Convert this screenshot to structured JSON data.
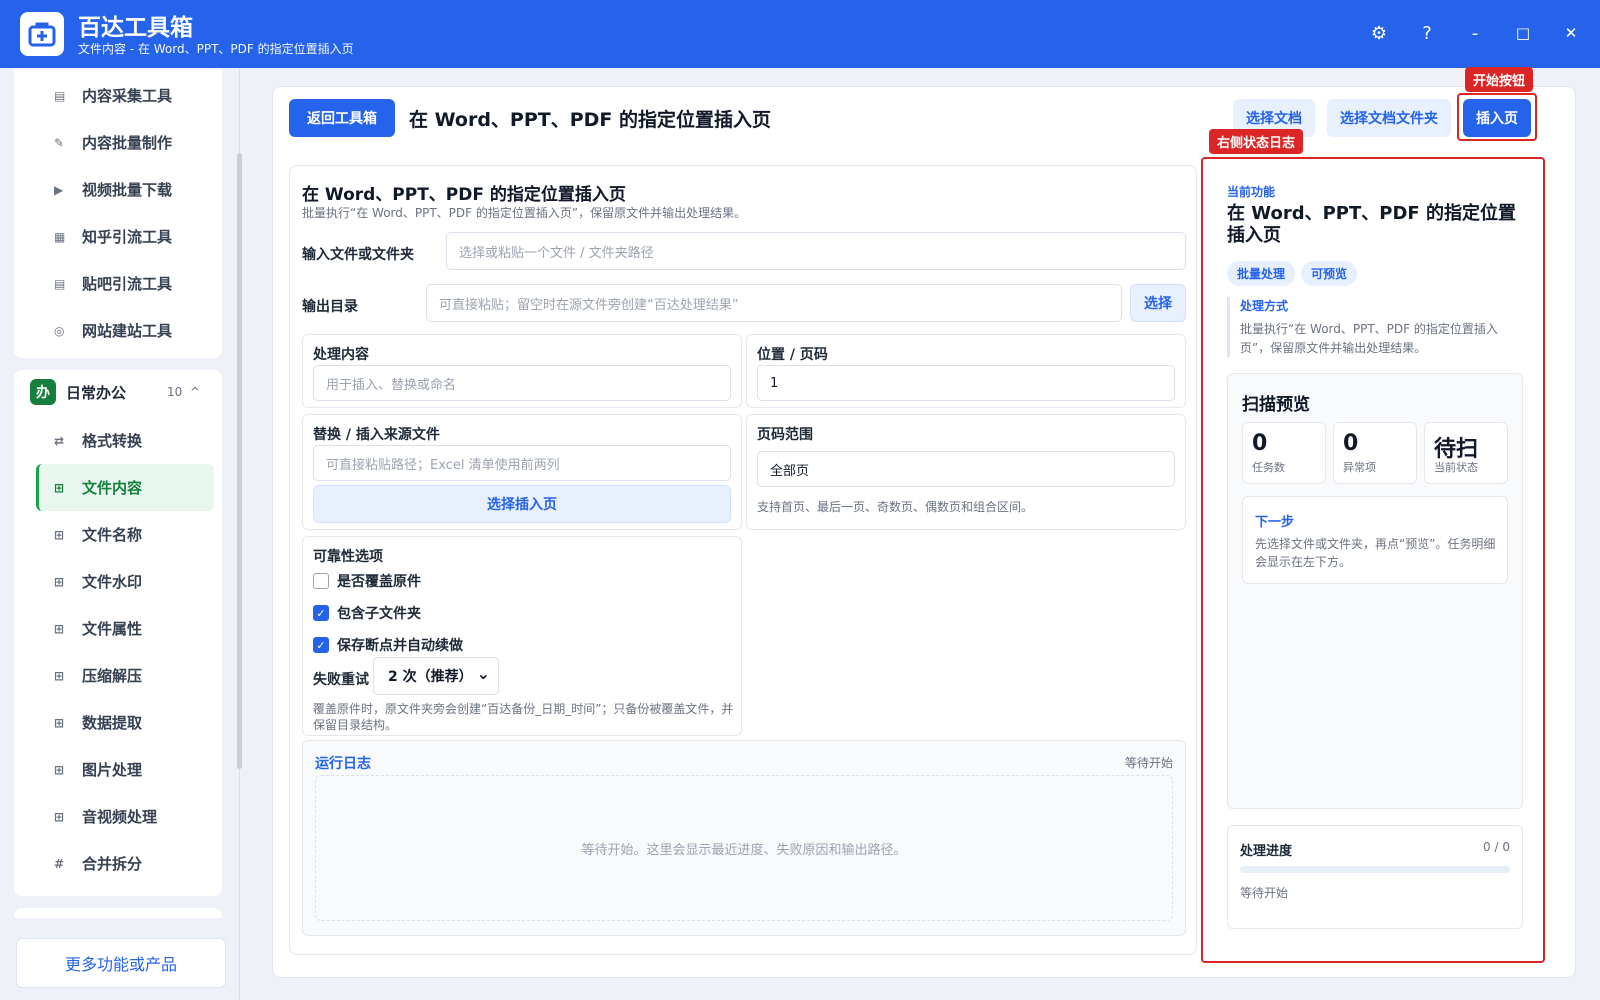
{
  "app": {
    "title": "百达工具箱",
    "subtitle": "文件内容 - 在 Word、PPT、PDF 的指定位置插入页"
  },
  "window": {
    "settings": "⚙",
    "help": "?",
    "minimize": "-",
    "maximize": "□",
    "close": "✕"
  },
  "sidebar": {
    "top_items": [
      {
        "label": "内容采集工具",
        "icon": "▤"
      },
      {
        "label": "内容批量制作",
        "icon": "✎"
      },
      {
        "label": "视频批量下载",
        "icon": "▶"
      },
      {
        "label": "知乎引流工具",
        "icon": "▦"
      },
      {
        "label": "贴吧引流工具",
        "icon": "▤"
      },
      {
        "label": "网站建站工具",
        "icon": "◎"
      }
    ],
    "group": {
      "badge": "办",
      "title": "日常办公",
      "count": "10",
      "chevron": "^"
    },
    "group_items": [
      {
        "label": "格式转换",
        "icon": "⇄"
      },
      {
        "label": "文件内容",
        "icon": "⊞"
      },
      {
        "label": "文件名称",
        "icon": "⊞"
      },
      {
        "label": "文件水印",
        "icon": "⊞"
      },
      {
        "label": "文件属性",
        "icon": "⊞"
      },
      {
        "label": "压缩解压",
        "icon": "⊞"
      },
      {
        "label": "数据提取",
        "icon": "⊞"
      },
      {
        "label": "图片处理",
        "icon": "⊞"
      },
      {
        "label": "音视频处理",
        "icon": "⊞"
      },
      {
        "label": "合并拆分",
        "icon": "#"
      }
    ],
    "more_button": "更多功能或产品"
  },
  "header": {
    "back": "返回工具箱",
    "title": "在 Word、PPT、PDF 的指定位置插入页",
    "select_file": "选择文档",
    "select_folder": "选择文档文件夹",
    "start": "插入页",
    "start_annotation": "开始按钮",
    "log_annotation": "右侧状态日志"
  },
  "form": {
    "title": "在 Word、PPT、PDF 的指定位置插入页",
    "subtitle": "批量执行“在 Word、PPT、PDF 的指定位置插入页”，保留原文件并输出处理结果。",
    "input_label": "输入文件或文件夹",
    "input_placeholder": "选择或粘贴一个文件 / 文件夹路径",
    "output_label": "输出目录",
    "output_placeholder": "可直接粘贴；留空时在源文件旁创建“百达处理结果”",
    "output_pick": "选择",
    "content_label": "处理内容",
    "content_placeholder": "用于插入、替换或命名",
    "position_label": "位置 / 页码",
    "position_value": "1",
    "source_label": "替换 / 插入来源文件",
    "source_placeholder": "可直接粘贴路径；Excel 清单使用前两列",
    "source_pick": "选择插入页",
    "range_label": "页码范围",
    "range_value": "全部页",
    "range_hint": "支持首页、最后一页、奇数页、偶数页和组合区间。",
    "reliability_label": "可靠性选项",
    "overwrite": "是否覆盖原件",
    "subfolders": "包含子文件夹",
    "resume": "保存断点并自动续做",
    "retry_label": "失败重试",
    "retry_value": "2 次（推荐）",
    "retry_chevron": "⌄",
    "backup_hint": "覆盖原件时，原文件夹旁会创建“百达备份_日期_时间”；只备份被覆盖文件，并保留目录结构。"
  },
  "log": {
    "title": "运行日志",
    "status": "等待开始",
    "empty": "等待开始。这里会显示最近进度、失败原因和输出路径。"
  },
  "panel": {
    "current_label": "当前功能",
    "current_title": "在 Word、PPT、PDF 的指定位置插入页",
    "tags": [
      "批量处理",
      "可预览"
    ],
    "method_label": "处理方式",
    "method_text": "批量执行“在 Word、PPT、PDF 的指定位置插入页”，保留原文件并输出处理结果。",
    "scan_title": "扫描预览",
    "stats": [
      {
        "value": "0",
        "label": "任务数"
      },
      {
        "value": "0",
        "label": "异常项"
      },
      {
        "value": "待扫",
        "label": "当前状态"
      }
    ],
    "next_title": "下一步",
    "next_text": "先选择文件或文件夹，再点“预览”。任务明细会显示在左下方。",
    "progress_label": "处理进度",
    "progress_count": "0 / 0",
    "progress_fraction": 0,
    "progress_status": "等待开始"
  }
}
